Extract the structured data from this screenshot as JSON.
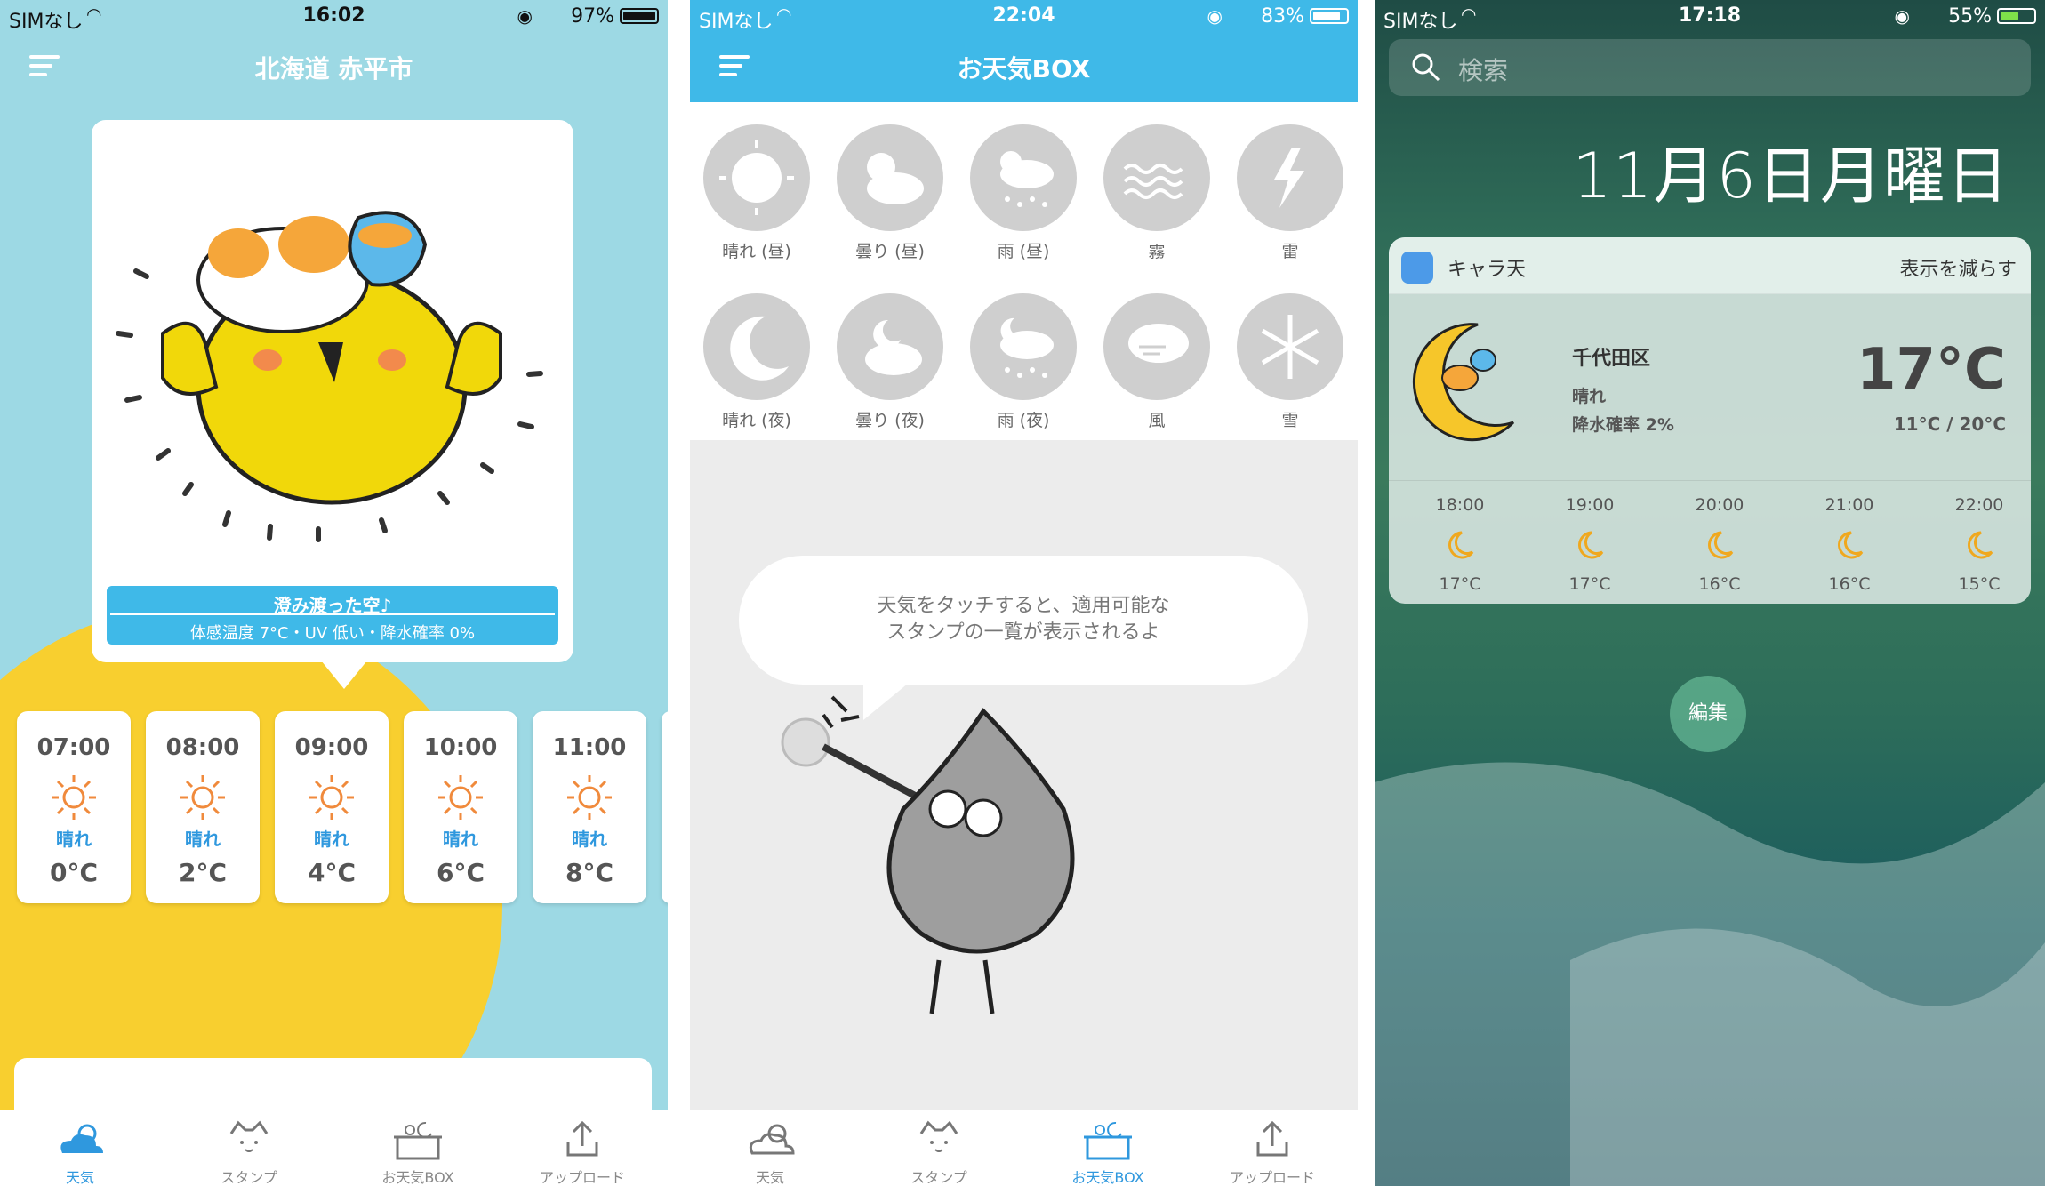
{
  "panel1": {
    "status": {
      "carrier": "SIMなし",
      "time": "16:02",
      "battery": "97%"
    },
    "title": "北海道 赤平市",
    "banner": {
      "main": "澄み渡った空♪",
      "sub": "体感温度 7°C・UV 低い・降水確率 0%"
    },
    "hours": [
      {
        "time": "07:00",
        "cond": "晴れ",
        "temp": "0°C"
      },
      {
        "time": "08:00",
        "cond": "晴れ",
        "temp": "2°C"
      },
      {
        "time": "09:00",
        "cond": "晴れ",
        "temp": "4°C"
      },
      {
        "time": "10:00",
        "cond": "晴れ",
        "temp": "6°C"
      },
      {
        "time": "11:00",
        "cond": "晴れ",
        "temp": "8°C"
      }
    ],
    "tabs": [
      "天気",
      "スタンプ",
      "お天気BOX",
      "アップロード"
    ]
  },
  "panel2": {
    "status": {
      "carrier": "SIMなし",
      "time": "22:04",
      "battery": "83%"
    },
    "title": "お天気BOX",
    "icons": [
      {
        "label": "晴れ (昼)",
        "icon": "sun-icon"
      },
      {
        "label": "曇り (昼)",
        "icon": "cloud-sun-icon"
      },
      {
        "label": "雨 (昼)",
        "icon": "rain-sun-icon"
      },
      {
        "label": "霧",
        "icon": "fog-icon"
      },
      {
        "label": "雷",
        "icon": "thunder-icon"
      },
      {
        "label": "晴れ (夜)",
        "icon": "moon-icon"
      },
      {
        "label": "曇り (夜)",
        "icon": "cloud-moon-icon"
      },
      {
        "label": "雨 (夜)",
        "icon": "rain-moon-icon"
      },
      {
        "label": "風",
        "icon": "wind-icon"
      },
      {
        "label": "雪",
        "icon": "snow-icon"
      }
    ],
    "bubble": {
      "line1": "天気をタッチすると、適用可能な",
      "line2": "スタンプの一覧が表示されるよ"
    },
    "tabs": [
      "天気",
      "スタンプ",
      "お天気BOX",
      "アップロード"
    ]
  },
  "panel3": {
    "status": {
      "carrier": "SIMなし",
      "time": "17:18",
      "battery": "55%"
    },
    "search": "検索",
    "date": "11月6日月曜日",
    "widget": {
      "app": "キャラ天",
      "less": "表示を減らす",
      "location": "千代田区",
      "cond": "晴れ",
      "rain": "降水確率 2%",
      "temp": "17°C",
      "hilo": "11°C / 20°C",
      "hours": [
        {
          "time": "18:00",
          "temp": "17°C"
        },
        {
          "time": "19:00",
          "temp": "17°C"
        },
        {
          "time": "20:00",
          "temp": "16°C"
        },
        {
          "time": "21:00",
          "temp": "16°C"
        },
        {
          "time": "22:00",
          "temp": "15°C"
        }
      ]
    },
    "edit": "編集"
  }
}
